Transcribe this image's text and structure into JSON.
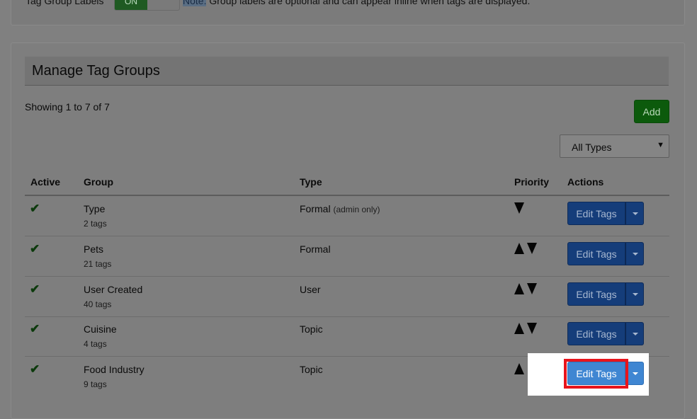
{
  "top_settings": {
    "tag_group_labels": "Tag Group Labels",
    "toggle_state": "ON",
    "note_prefix": "Note:",
    "note_text": " Group labels are optional and can appear inline when tags are displayed."
  },
  "section": {
    "title": "Manage Tag Groups",
    "showing": "Showing 1 to 7 of 7",
    "add_label": "Add",
    "type_filter": "All Types"
  },
  "table": {
    "headers": {
      "active": "Active",
      "group": "Group",
      "type": "Type",
      "priority": "Priority",
      "actions": "Actions"
    },
    "edit_label": "Edit Tags",
    "rows": [
      {
        "name": "Type",
        "count": "2 tags",
        "type": "Formal",
        "type_note": "(admin only)",
        "priority": [
          "down"
        ]
      },
      {
        "name": "Pets",
        "count": "21 tags",
        "type": "Formal",
        "type_note": "",
        "priority": [
          "up",
          "down"
        ]
      },
      {
        "name": "User Created",
        "count": "40 tags",
        "type": "User",
        "type_note": "",
        "priority": [
          "up",
          "down"
        ]
      },
      {
        "name": "Cuisine",
        "count": "4 tags",
        "type": "Topic",
        "type_note": "",
        "priority": [
          "up",
          "down"
        ]
      },
      {
        "name": "Food Industry",
        "count": "9 tags",
        "type": "Topic",
        "type_note": "",
        "priority": [
          "up"
        ]
      }
    ]
  },
  "colors": {
    "overlay": "#808080",
    "add_button": "#0c5a0c",
    "edit_button": "#153d7a",
    "highlight_button": "#3f86d2",
    "highlight_border": "#e8141c"
  },
  "icons": {
    "active": "check-icon",
    "priority_up": "arrow-up-icon",
    "priority_down": "arrow-down-icon",
    "dropdown": "caret-down-icon"
  }
}
